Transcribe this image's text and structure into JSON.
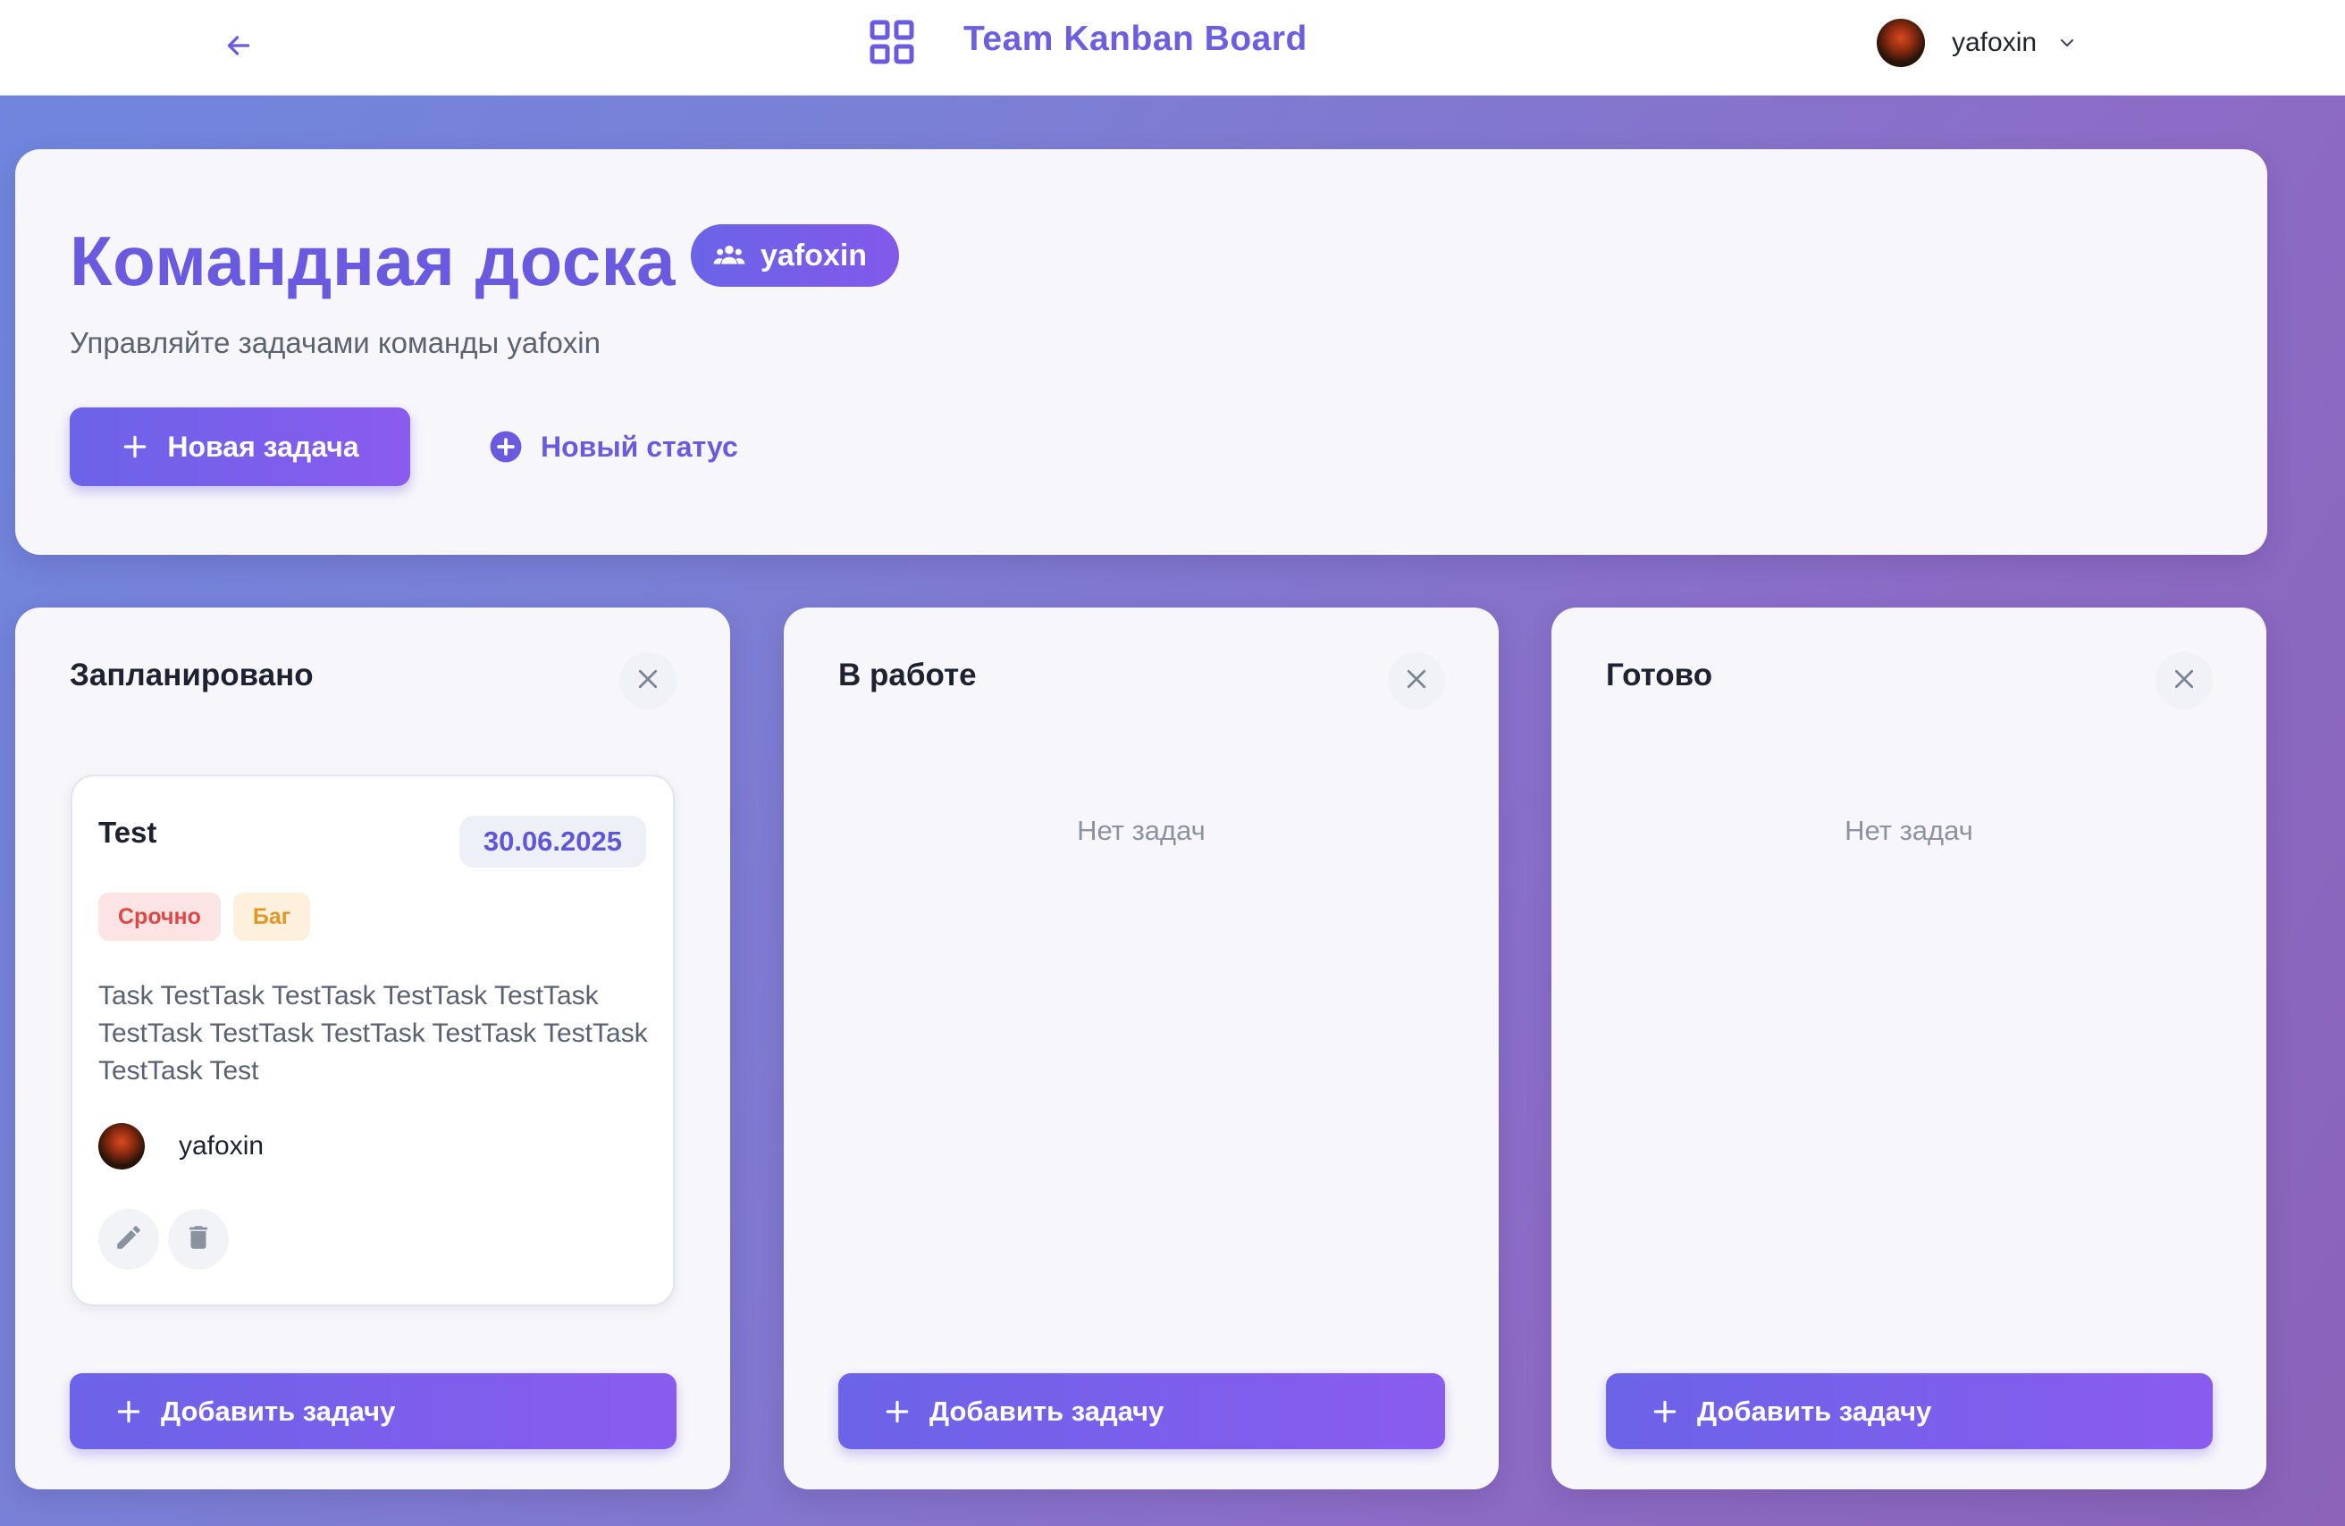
{
  "topbar": {
    "app_title": "Team Kanban Board",
    "user_name": "yafoxin"
  },
  "header": {
    "title": "Командная доска",
    "team_badge": "yafoxin",
    "subtitle": "Управляйте задачами команды yafoxin",
    "new_task_label": "Новая задача",
    "new_status_label": "Новый статус"
  },
  "columns": [
    {
      "title": "Запланировано",
      "add_task_label": "Добавить задачу",
      "tasks": [
        {
          "title": "Test",
          "date": "30.06.2025",
          "tags": [
            "Срочно",
            "Баг"
          ],
          "description": "Task TestTask TestTask TestTask TestTask TestTask TestTask TestTask TestTask TestTask TestTask Test",
          "assignee": "yafoxin"
        }
      ]
    },
    {
      "title": "В работе",
      "empty_text": "Нет задач",
      "add_task_label": "Добавить задачу"
    },
    {
      "title": "Готово",
      "empty_text": "Нет задач",
      "add_task_label": "Добавить задачу"
    }
  ],
  "colors": {
    "accent": "#6a5ae0",
    "button_gradient_start": "#6b63e8",
    "button_gradient_end": "#8a5bef",
    "tag_urgent": "#e04848",
    "tag_bug": "#e0982a"
  },
  "icons": {
    "back": "arrow-left-icon",
    "app": "grid-icon",
    "dropdown": "chevron-down-icon",
    "team": "users-icon",
    "plus": "plus-icon",
    "plus_circle": "plus-circle-icon",
    "close": "close-icon",
    "edit": "pencil-icon",
    "delete": "trash-icon"
  }
}
